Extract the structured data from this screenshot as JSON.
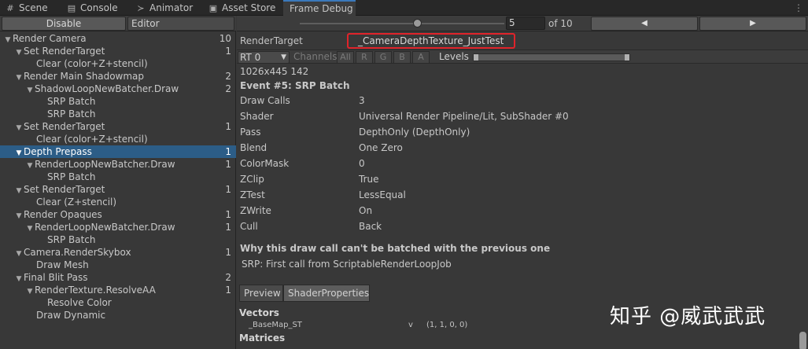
{
  "tabs": [
    {
      "label": "Scene",
      "icon": "grid-icon"
    },
    {
      "label": "Console",
      "icon": "console-icon"
    },
    {
      "label": "Animator",
      "icon": "animator-icon"
    },
    {
      "label": "Asset Store",
      "icon": "bag-icon"
    },
    {
      "label": "Frame Debug",
      "icon": "frame-debug-icon",
      "active": true
    }
  ],
  "tab_menu": "⋮",
  "left_toolbar": {
    "disable_label": "Disable",
    "editor_label": "Editor"
  },
  "tree": [
    {
      "label": "Render Camera",
      "count": "10",
      "expanded": true,
      "selected": false
    },
    {
      "label": "Set RenderTarget",
      "count": "1",
      "expanded": true,
      "selected": false
    },
    {
      "label": "Clear (color+Z+stencil)",
      "count": "",
      "expanded": false,
      "selected": false
    },
    {
      "label": "Render Main Shadowmap",
      "count": "2",
      "expanded": true,
      "selected": false
    },
    {
      "label": "ShadowLoopNewBatcher.Draw",
      "count": "2",
      "expanded": true,
      "selected": false
    },
    {
      "label": "SRP Batch",
      "count": "",
      "expanded": false,
      "selected": false
    },
    {
      "label": "SRP Batch",
      "count": "",
      "expanded": false,
      "selected": false
    },
    {
      "label": "Set RenderTarget",
      "count": "1",
      "expanded": true,
      "selected": false
    },
    {
      "label": "Clear (color+Z+stencil)",
      "count": "",
      "expanded": false,
      "selected": false
    },
    {
      "label": "Depth Prepass",
      "count": "1",
      "expanded": true,
      "selected": true
    },
    {
      "label": "RenderLoopNewBatcher.Draw",
      "count": "1",
      "expanded": true,
      "selected": false
    },
    {
      "label": "SRP Batch",
      "count": "",
      "expanded": false,
      "selected": false
    },
    {
      "label": "Set RenderTarget",
      "count": "1",
      "expanded": true,
      "selected": false
    },
    {
      "label": "Clear (Z+stencil)",
      "count": "",
      "expanded": false,
      "selected": false
    },
    {
      "label": "Render Opaques",
      "count": "1",
      "expanded": true,
      "selected": false
    },
    {
      "label": "RenderLoopNewBatcher.Draw",
      "count": "1",
      "expanded": true,
      "selected": false
    },
    {
      "label": "SRP Batch",
      "count": "",
      "expanded": false,
      "selected": false
    },
    {
      "label": "Camera.RenderSkybox",
      "count": "1",
      "expanded": true,
      "selected": false
    },
    {
      "label": "Draw Mesh",
      "count": "",
      "expanded": false,
      "selected": false
    },
    {
      "label": "Final Blit Pass",
      "count": "2",
      "expanded": true,
      "selected": false
    },
    {
      "label": "RenderTexture.ResolveAA",
      "count": "1",
      "expanded": true,
      "selected": false
    },
    {
      "label": "Resolve Color",
      "count": "",
      "expanded": false,
      "selected": false
    },
    {
      "label": "Draw Dynamic",
      "count": "",
      "expanded": false,
      "selected": false
    }
  ],
  "frame_nav": {
    "current": "5",
    "total_label": "of 10",
    "slider_fraction": 0.5,
    "prev": "◀",
    "next": "▶"
  },
  "render_target": {
    "label": "RenderTarget",
    "value": "_CameraDepthTexture_JustTest"
  },
  "channels": {
    "rt_select": "RT 0",
    "channels_label": "Channels",
    "buttons": [
      "All",
      "R",
      "G",
      "B",
      "A"
    ],
    "levels_label": "Levels"
  },
  "info": {
    "size": "1026x445 142",
    "event_title": "Event #5: SRP Batch",
    "props": [
      {
        "k": "Draw Calls",
        "v": "3"
      },
      {
        "k": "Shader",
        "v": "Universal Render Pipeline/Lit, SubShader #0"
      },
      {
        "k": "Pass",
        "v": "DepthOnly (DepthOnly)"
      },
      {
        "k": "Blend",
        "v": "One Zero"
      },
      {
        "k": "ColorMask",
        "v": "0"
      },
      {
        "k": "ZClip",
        "v": "True"
      },
      {
        "k": "ZTest",
        "v": "LessEqual"
      },
      {
        "k": "ZWrite",
        "v": "On"
      },
      {
        "k": "Cull",
        "v": "Back"
      }
    ],
    "batch_title": "Why this draw call can't be batched with the previous one",
    "batch_reason": "SRP: First call from ScriptableRenderLoopJob"
  },
  "bottom_tabs": {
    "preview": "Preview",
    "shader_properties": "ShaderProperties"
  },
  "vectors": {
    "heading": "Vectors",
    "rows": [
      {
        "name": "_BaseMap_ST",
        "type": "v",
        "value": "(1, 1, 0, 0)"
      }
    ],
    "matrices_heading": "Matrices"
  },
  "watermark": "知乎 @威武武武"
}
